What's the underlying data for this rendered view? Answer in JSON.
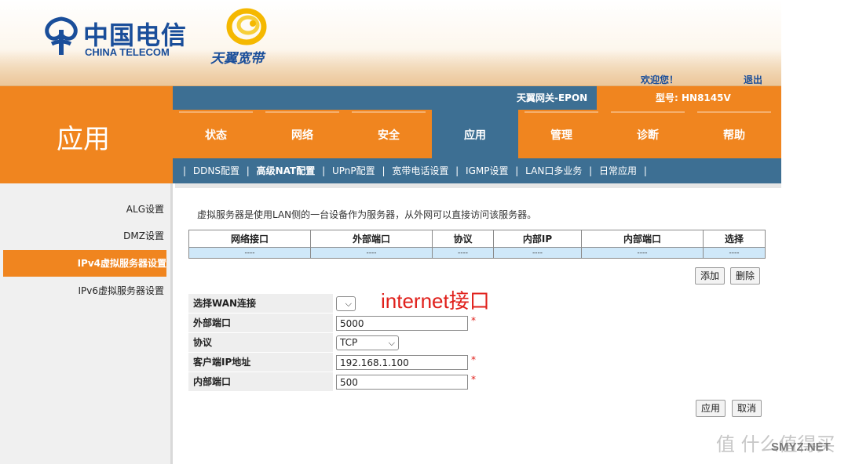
{
  "header": {
    "telecom_logo_cn": "中国电信",
    "telecom_logo_en": "CHINA TELECOM",
    "tianyi_logo_cn": "天翼宽带",
    "welcome": "欢迎您！",
    "logout": "退出"
  },
  "section_title": "应用",
  "infobar": {
    "device_name": "天翼网关-EPON",
    "model": "型号: HN8145V"
  },
  "nav": {
    "tabs": [
      {
        "label": "状态",
        "active": false
      },
      {
        "label": "网络",
        "active": false
      },
      {
        "label": "安全",
        "active": false
      },
      {
        "label": "应用",
        "active": true
      },
      {
        "label": "管理",
        "active": false
      },
      {
        "label": "诊断",
        "active": false
      },
      {
        "label": "帮助",
        "active": false
      }
    ]
  },
  "subnav": {
    "items": [
      {
        "label": "DDNS配置",
        "active": false
      },
      {
        "label": "高级NAT配置",
        "active": true
      },
      {
        "label": "UPnP配置",
        "active": false
      },
      {
        "label": "宽带电话设置",
        "active": false
      },
      {
        "label": "IGMP设置",
        "active": false
      },
      {
        "label": "LAN口多业务",
        "active": false
      },
      {
        "label": "日常应用",
        "active": false
      }
    ]
  },
  "sidebar": {
    "items": [
      {
        "label": "ALG设置",
        "active": false
      },
      {
        "label": "DMZ设置",
        "active": false
      },
      {
        "label": "IPv4虚拟服务器设置",
        "active": true
      },
      {
        "label": "IPv6虚拟服务器设置",
        "active": false
      }
    ]
  },
  "content": {
    "description": "虚拟服务器是使用LAN侧的一台设备作为服务器，从外网可以直接访问该服务器。",
    "table": {
      "headers": [
        "网络接口",
        "外部端口",
        "协议",
        "内部IP",
        "内部端口",
        "选择"
      ],
      "rows": [
        [
          "----",
          "----",
          "----",
          "----",
          "----",
          "----"
        ]
      ]
    },
    "add_button": "添加",
    "delete_button": "删除",
    "form": {
      "wan_label": "选择WAN连接",
      "wan_value": "",
      "ext_port_label": "外部端口",
      "ext_port_value": "5000",
      "protocol_label": "协议",
      "protocol_value": "TCP",
      "client_ip_label": "客户端IP地址",
      "client_ip_value": "192.168.1.100",
      "int_port_label": "内部端口",
      "int_port_value": "500",
      "required_mark": "*"
    },
    "apply_button": "应用",
    "cancel_button": "取消",
    "annotation": "internet接口"
  },
  "watermark": {
    "text": "值 什么值得买",
    "site": "SMYZ.NET"
  },
  "colors": {
    "orange": "#f0851f",
    "blue": "#3d6f93",
    "table_row": "#cfe8f9",
    "annotation_red": "#e0201b"
  }
}
